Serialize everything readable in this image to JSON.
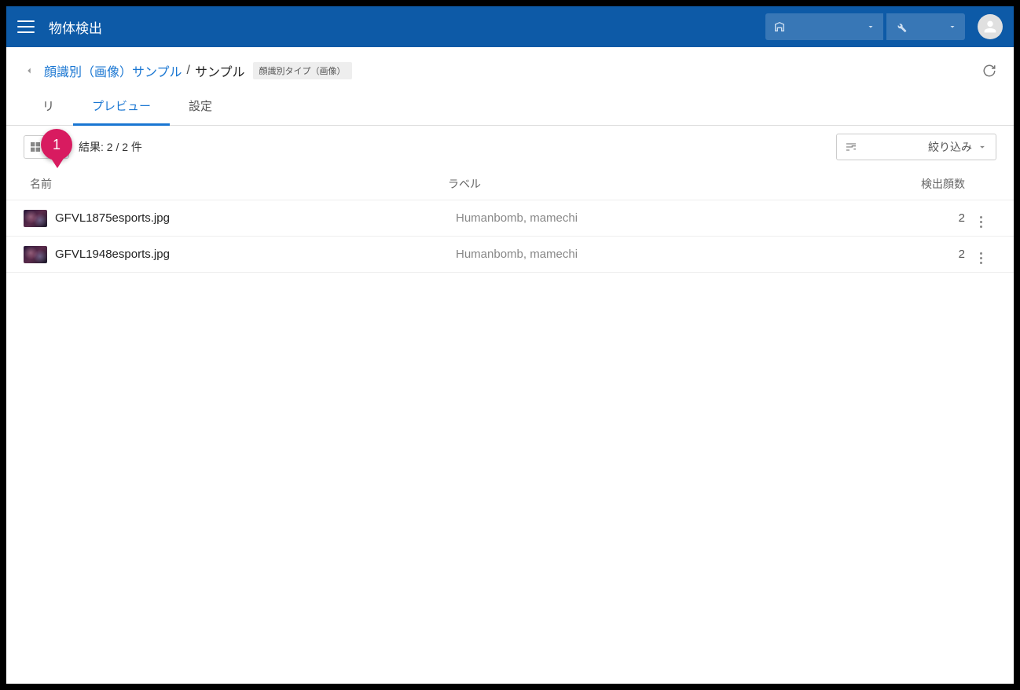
{
  "header": {
    "app_title": "物体検出"
  },
  "breadcrumb": {
    "parent": "顔識別（画像）サンプル",
    "separator": "/",
    "current": "サンプル",
    "tag": "顔識別タイプ（画像）"
  },
  "tabs": {
    "t0": "リ",
    "t1": "プレビュー",
    "t2": "設定"
  },
  "callout": {
    "num": "1"
  },
  "toolbar": {
    "result_text": "結果: 2 / 2 件",
    "filter_label": "絞り込み"
  },
  "columns": {
    "name": "名前",
    "label": "ラベル",
    "count": "検出顔数"
  },
  "rows": [
    {
      "name": "GFVL1875esports.jpg",
      "label": "Humanbomb, mamechi",
      "count": "2"
    },
    {
      "name": "GFVL1948esports.jpg",
      "label": "Humanbomb, mamechi",
      "count": "2"
    }
  ]
}
